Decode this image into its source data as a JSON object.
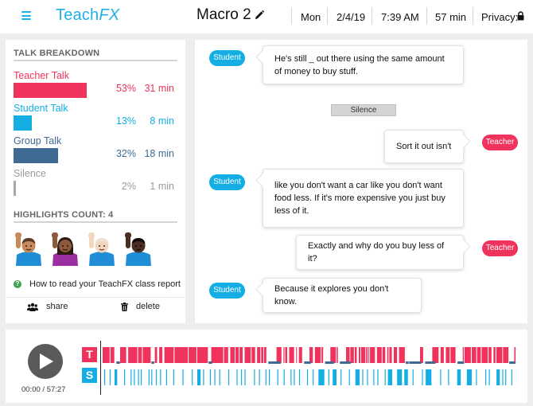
{
  "header": {
    "logo_main": "Teach",
    "logo_fx": "FX",
    "title": "Macro 2",
    "day": "Mon",
    "date": "2/4/19",
    "time": "7:39 AM",
    "duration": "57 min",
    "privacy_label": "Privacy:"
  },
  "talk_breakdown": {
    "heading": "TALK BREAKDOWN",
    "rows": [
      {
        "label": "Teacher Talk",
        "percent": "53%",
        "minutes": "31 min",
        "fraction": 0.53,
        "color": "#f0335d"
      },
      {
        "label": "Student Talk",
        "percent": "13%",
        "minutes": "8 min",
        "fraction": 0.13,
        "color": "#14aee5"
      },
      {
        "label": "Group Talk",
        "percent": "32%",
        "minutes": "18 min",
        "fraction": 0.32,
        "color": "#3f6a93"
      },
      {
        "label": "Silence",
        "percent": "2%",
        "minutes": "1 min",
        "fraction": 0.02,
        "color": "#a8a8a8"
      }
    ]
  },
  "highlights": {
    "heading": "HIGHLIGHTS COUNT: 4",
    "emojis": [
      "raised-hand-person-medium-skin",
      "raised-hand-person-dark-skin",
      "raised-hand-person-light-skin",
      "raised-hand-person-darkest-skin"
    ]
  },
  "help_link": "How to read your TeachFX class report",
  "actions": {
    "share_label": "share",
    "delete_label": "delete"
  },
  "transcript": {
    "student_tag": "Student",
    "teacher_tag": "Teacher",
    "silence_label": "Silence",
    "messages": [
      {
        "speaker": "Student",
        "text": "He's still _ out there using the same amount of money to buy stuff."
      },
      {
        "speaker": "Teacher",
        "text": "Sort it out isn't"
      },
      {
        "speaker": "Student",
        "text": "like you don't want a car like you don't want food less. If it's more expensive you just buy less of it."
      },
      {
        "speaker": "Teacher",
        "text": "Exactly and why do you buy less of it?"
      },
      {
        "speaker": "Student",
        "text": "Because it explores you don't know."
      }
    ]
  },
  "player": {
    "time_readout": "00:00 / 57:27",
    "teacher_track_letter": "T",
    "student_track_letter": "S"
  },
  "colors": {
    "brand": "#1fb0e6",
    "teacher": "#f0335d",
    "student": "#14aee5",
    "group": "#3f6a93"
  }
}
